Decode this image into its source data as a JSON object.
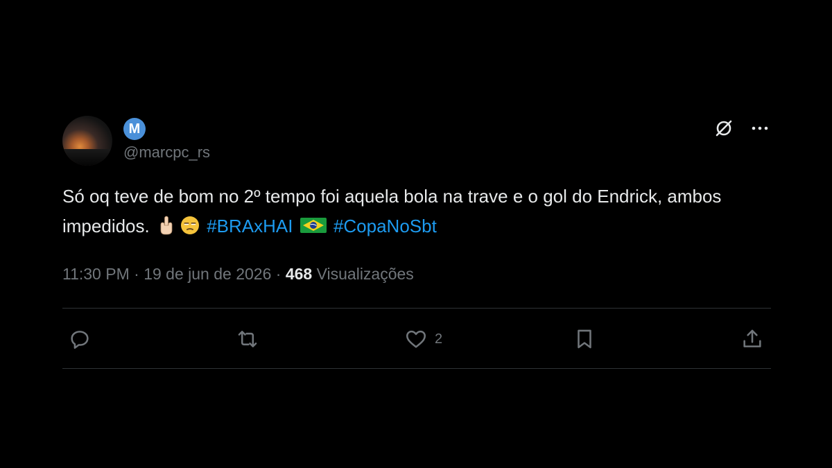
{
  "author": {
    "display_badge": "M",
    "handle": "@marcpc_rs"
  },
  "tweet": {
    "text_part1": "Só oq teve de bom no 2º tempo foi aquela bola na trave e o gol do Endrick, ambos impedidos.",
    "hashtag1": "#BRAxHAI",
    "hashtag2": "#CopaNoSbt",
    "emojis": [
      "middle-finger-emoji",
      "unamused-face-emoji",
      "brazil-flag-emoji"
    ]
  },
  "meta": {
    "time": "11:30 PM",
    "separator": "·",
    "date": "19 de jun de 2026",
    "views_count": "468",
    "views_label": "Visualizações"
  },
  "actions": {
    "reply_icon": "reply-icon",
    "retweet_icon": "retweet-icon",
    "like_icon": "heart-icon",
    "like_count": "2",
    "bookmark_icon": "bookmark-icon",
    "share_icon": "share-icon"
  },
  "colors": {
    "background": "#000000",
    "text": "#e7e9ea",
    "muted": "#71767b",
    "link": "#1d9bf0",
    "divider": "#2f3336",
    "badge": "#4a90d9"
  }
}
